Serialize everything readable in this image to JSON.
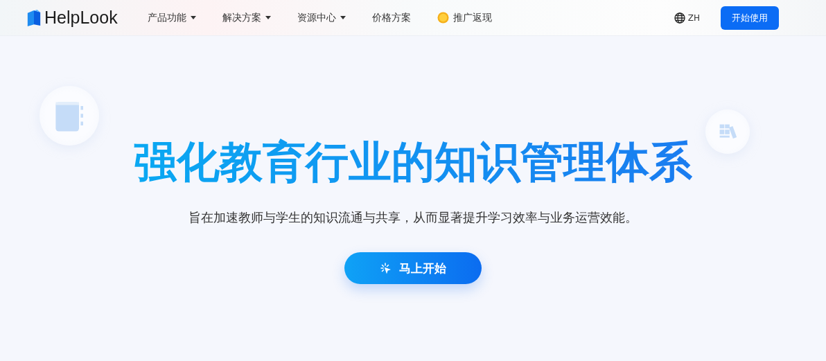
{
  "header": {
    "logo": "HelpLook",
    "nav": [
      {
        "label": "产品功能",
        "kind": "menu"
      },
      {
        "label": "解决方案",
        "kind": "menu"
      },
      {
        "label": "资源中心",
        "kind": "menu"
      },
      {
        "label": "价格方案",
        "kind": "link"
      },
      {
        "label": "推广返现",
        "kind": "promo"
      }
    ],
    "language": "ZH",
    "cta": "开始使用"
  },
  "hero": {
    "title": "强化教育行业的知识管理体系",
    "subtitle": "旨在加速教师与学生的知识流通与共享，从而显著提升学习效率与业务运营效能。",
    "button": "马上开始"
  }
}
